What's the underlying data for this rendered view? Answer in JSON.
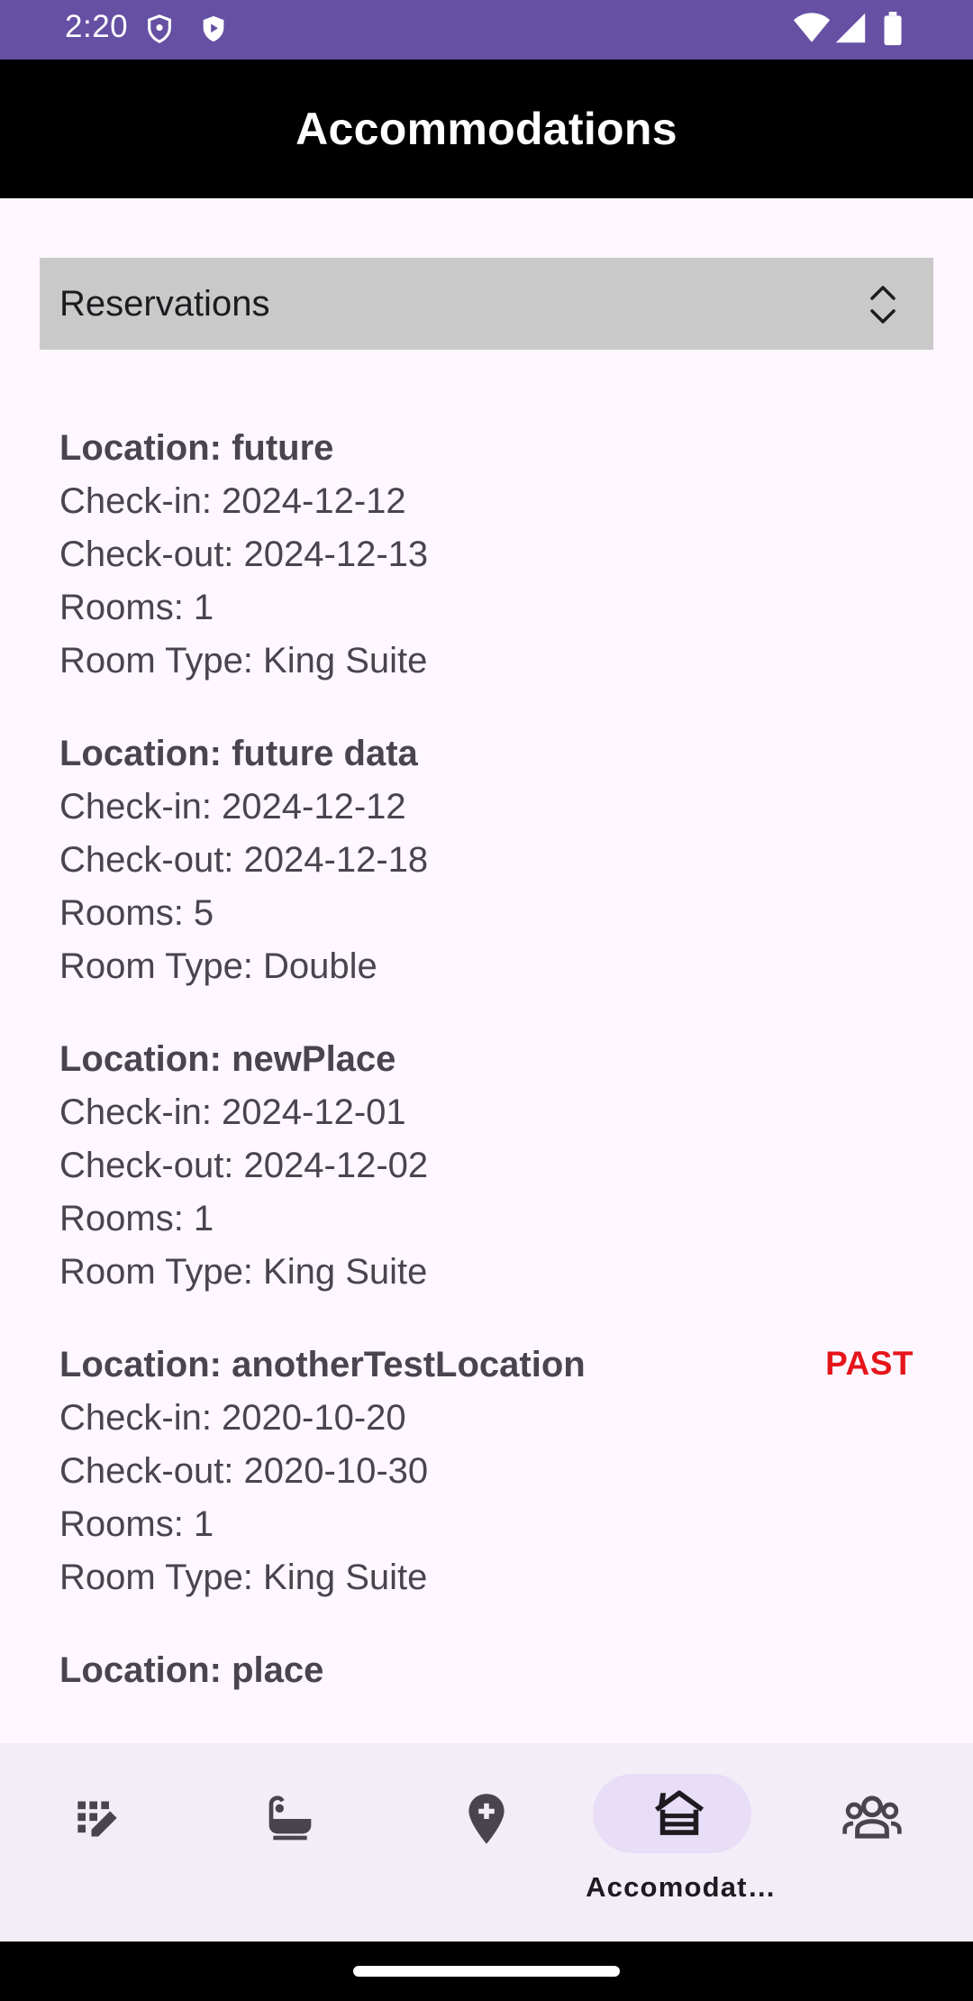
{
  "status_bar": {
    "time": "2:20",
    "icons": [
      "shield-icon",
      "play-shield-icon",
      "wifi-icon",
      "signal-icon",
      "battery-icon"
    ]
  },
  "app_bar": {
    "title": "Accommodations"
  },
  "dropdown": {
    "selected": "Reservations",
    "icon": "unfold-icon"
  },
  "reservations": [
    {
      "location": "Location: future",
      "check_in": "Check-in: 2024-12-12",
      "check_out": "Check-out: 2024-12-13",
      "rooms": "Rooms: 1",
      "room_type": "Room Type: King Suite",
      "badge": ""
    },
    {
      "location": "Location: future data",
      "check_in": "Check-in: 2024-12-12",
      "check_out": "Check-out: 2024-12-18",
      "rooms": "Rooms: 5",
      "room_type": "Room Type: Double",
      "badge": ""
    },
    {
      "location": "Location: newPlace",
      "check_in": "Check-in: 2024-12-01",
      "check_out": "Check-out: 2024-12-02",
      "rooms": "Rooms: 1",
      "room_type": "Room Type: King Suite",
      "badge": ""
    },
    {
      "location": "Location: anotherTestLocation",
      "check_in": "Check-in: 2020-10-20",
      "check_out": "Check-out: 2020-10-30",
      "rooms": "Rooms: 1",
      "room_type": "Room Type: King Suite",
      "badge": "PAST"
    },
    {
      "location": "Location: place",
      "check_in": "",
      "check_out": "",
      "rooms": "",
      "room_type": "",
      "badge": ""
    }
  ],
  "fab": {
    "icon": "add-icon"
  },
  "nav": {
    "items": [
      {
        "icon": "edit-note-icon",
        "label": "",
        "active": false
      },
      {
        "icon": "bathtub-icon",
        "label": "",
        "active": false
      },
      {
        "icon": "add-location-icon",
        "label": "",
        "active": false
      },
      {
        "icon": "cabin-icon",
        "label": "Accomodat…",
        "active": true
      },
      {
        "icon": "groups-icon",
        "label": "",
        "active": false
      }
    ]
  },
  "colors": {
    "status_bar": "#6650a4",
    "app_bar": "#000000",
    "background": "#fef7ff",
    "dropdown": "#c9c9c9",
    "text": "#49454f",
    "past_badge": "#e6151b",
    "fab": "#eaddff",
    "nav_background": "#f3edf7",
    "nav_active_pill": "#e8def8"
  }
}
